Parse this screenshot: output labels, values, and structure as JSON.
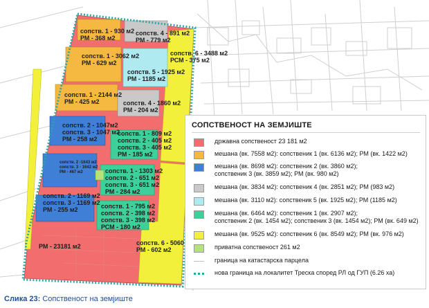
{
  "labels": {
    "l1a": "сопств. 1 - 930 м2",
    "l1b": "РМ - 368 м2",
    "l2a": "сопств. 4 - 891 м2",
    "l2b": "РМ - 779 м2",
    "l3a": "сопств. 6 - 3488 м2",
    "l3b": "РСМ - 375 м2",
    "l4a": "сопств. 1 - 3062 м2",
    "l4b": "РМ - 629 м2",
    "l5a": "сопств. 5 - 1925 м2",
    "l5b": "РМ - 1185 м2",
    "l6a": "сопств. 1 - 2144 м2",
    "l6b": "РМ - 425 м2",
    "l7a": "сопств. 4 - 1860 м2",
    "l7b": "РМ - 204 м2",
    "l8a": "сопств. 2 - 1047м2",
    "l8b": "сопств. 3 - 1047 м2",
    "l8c": "РМ - 258 м2",
    "l9a": "сопств. 1 - 809 м2",
    "l9b": "сопств. 2 - 405 м2",
    "l9c": "сопств. 3 - 405 м2",
    "l9d": "РМ - 185 м2",
    "l10a": "сопств. 2 -1643 м2",
    "l10b": "сопств. 3 - 1642 м2",
    "l10c": "РМ - 467 м2",
    "l11a": "сопств. 1 - 1303 м2",
    "l11b": "сопств. 2 - 651 м2",
    "l11c": "сопств. 3 - 651 м2",
    "l11d": "РМ - 284 м2",
    "l12a": "сопств. 2 - 1169 м2",
    "l12b": "сопств. 3 - 1169 м2",
    "l12c": "РМ - 255 м2",
    "l13a": "сопств. 1 - 795 м2",
    "l13b": "сопств. 2 - 398 м2",
    "l13c": "сопств. 3 - 398 м2",
    "l13d": "РСМ - 180 м2",
    "l14": "РМ - 23181 м2",
    "l15a": "сопств. 6 - 5060 м2",
    "l15b": "РМ - 602 м2"
  },
  "legend": {
    "title": "СОПСТВЕНОСТ НА ЗЕМЈИШТЕ",
    "items": [
      {
        "color": "#f26d6d",
        "text": "државна сопственост 23 181 м2"
      },
      {
        "color": "#f5b942",
        "text": "мешана (вк. 7558 м2): сопственик 1 (вк. 6136 м2); РМ (вк. 1422 м2)"
      },
      {
        "color": "#3f7fd6",
        "text": "мешана (вк. 8698 м2): сопственик 2 (вк. 3860 м2);",
        "text2": "сопственик 3 (вк. 3859 м2); РМ (вк. 980 м2)"
      },
      {
        "color": "#c9c9c9",
        "text": "мешана (вк. 3834 м2): сопственик 4 (вк. 2851 м2); РМ (983 м2)"
      },
      {
        "color": "#aeeaf0",
        "text": "мешана (вк. 3110 м2): сопственик 5 (вк. 1925 м2); РМ (1185 м2)"
      },
      {
        "color": "#3fcf9a",
        "text": "мешана (вк. 6464 м2): сопственик 1 (вк. 2907 м2);",
        "text2": "сопственик 2 (вк. 1454 м2); сопственик 3 (вк. 1454 м2); РМ (вк. 649 м2)"
      },
      {
        "color": "#f2f03a",
        "text": "мешана (вк. 9525 м2): сопственик 6 (вк. 8549 м2); РМ (вк. 976 м2)"
      },
      {
        "color": "#b6e27a",
        "text": "приватна сопственост 261 м2"
      },
      {
        "color": "#bdbdbd",
        "text": "граница на катастарска парцела"
      },
      {
        "color": "#2aa6a6",
        "text": "нова граница на локалитет Треска според РЛ од ГУП (6.26 ха)"
      }
    ]
  },
  "caption": {
    "figure": "Слика 23:",
    "text": "Сопственост на земјиште"
  }
}
